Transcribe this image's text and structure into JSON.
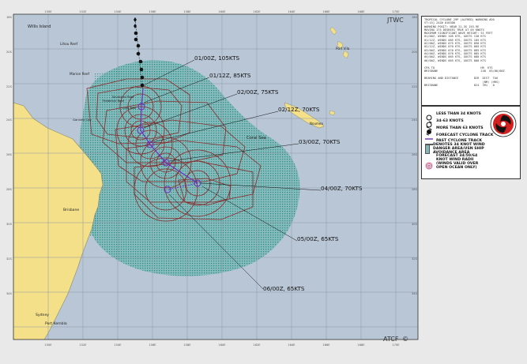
{
  "header": {
    "agency": "JTWC",
    "footer_mark": "ATCF",
    "footer_mark_symbol": "©"
  },
  "map": {
    "ocean_color": "#b8c6d6",
    "land_color": "#f3e089",
    "danger_area_color": "#7fb8b6",
    "track_color": "#6a2fbf",
    "radii_color": "#8a2a2a",
    "lat_labels": [
      "18S",
      "20S",
      "22S",
      "24S",
      "26S",
      "28S",
      "30S",
      "32S",
      "34S"
    ],
    "lon_labels": [
      "150E",
      "152E",
      "154E",
      "156E",
      "158E",
      "160E",
      "162E",
      "164E",
      "166E",
      "168E",
      "170E"
    ],
    "places": [
      "Willis Island",
      "Lihou Reef",
      "Marion Reef",
      "Frederick Reef",
      "Saumarez Reef",
      "Cato Reef",
      "Gannett Cay",
      "Port Vila",
      "Noumea",
      "Coral Sea",
      "Brisbane",
      "Sydney",
      "Port Kembla"
    ],
    "forecast_labels": [
      "01/00Z, 105KTS",
      "01/12Z, 85KTS",
      "02/00Z, 75KTS",
      "02/12Z, 70KTS",
      "03/00Z, 70KTS",
      "04/00Z, 70KTS",
      "05/00Z, 65KTS",
      "06/00Z, 65KTS"
    ]
  },
  "info_panel": {
    "lines": [
      "TROPICAL CYCLONE 29P (ALFRED) WARNING #20",
      "VT:15] 24Z# 010300",
      "WARNING POSIT: NEAR 21.3S 155.9E",
      "MOVING 175 DEGREES TRUE AT 05 KNOTS",
      "MAXIMUM SIGNIFICANT WAVE HEIGHT: 51 FEET",
      "01/00Z, WINDS 105 KTS, GUSTS 130 KTS",
      "01/12Z, WINDS 085 KTS, GUSTS 105 KTS",
      "02/00Z, WINDS 075 KTS, GUSTS 090 KTS",
      "02/12Z, WINDS 070 KTS, GUSTS 085 KTS",
      "03/00Z, WINDS 070 KTS, GUSTS 085 KTS",
      "04/00Z, WINDS 070 KTS, GUSTS 085 KTS",
      "05/00Z, WINDS 065 KTS, GUSTS 080 KTS",
      "06/00Z, WINDS 065 KTS, GUSTS 080 KTS"
    ],
    "cpa_header": [
      "CPA TO",
      "HR",
      "KTS"
    ],
    "cpa_row": [
      "BRISBANE",
      "240",
      "03/06/00Z"
    ],
    "bearing_header": [
      "BEARING AND DISTANCE",
      "DIR",
      "DIST",
      "TAU"
    ],
    "bearing_units": [
      "(NM)",
      "(HRS)"
    ],
    "bearing_row": [
      "BRISBANE",
      "024",
      "391",
      "0"
    ]
  },
  "legend": {
    "items": [
      "LESS THAN 34 KNOTS",
      "34-63 KNOTS",
      "MORE THAN 63 KNOTS",
      "FORECAST CYCLONE TRACK",
      "PAST CYCLONE TRACK",
      "DENOTES 34 KNOT WIND DANGER AREA/USN SHIP AVOIDANCE AREA",
      "FORECAST 34/50/64 KNOT WIND RADII (WINDS VALID OVER OPEN OCEAN ONLY)"
    ]
  }
}
